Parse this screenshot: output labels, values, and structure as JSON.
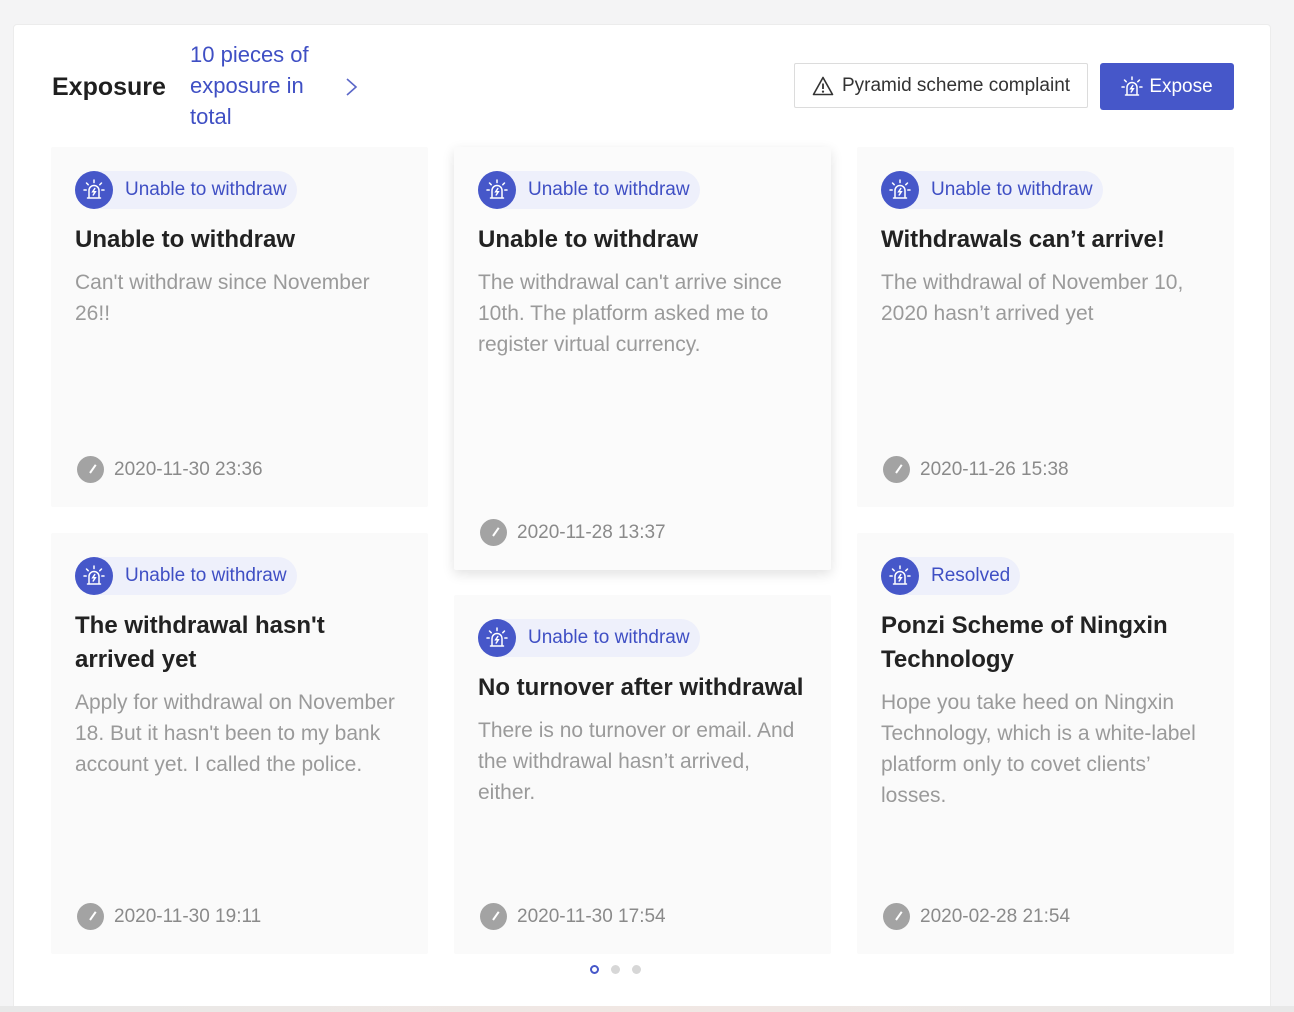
{
  "header": {
    "title": "Exposure",
    "count_link": "10 pieces of exposure in total",
    "complaint_button": "Pyramid scheme complaint",
    "expose_button": "Expose"
  },
  "cards": [
    {
      "tag": "Unable to withdraw",
      "title": "Unable to withdraw",
      "desc": "Can't withdraw since November 26!!",
      "time": "2020-11-30 23:36"
    },
    {
      "tag": "Unable to withdraw",
      "title": "Unable to withdraw",
      "desc": "The withdrawal can't arrive since 10th. The platform asked me to register virtual currency.",
      "time": "2020-11-28 13:37"
    },
    {
      "tag": "Unable to withdraw",
      "title": "Withdrawals can’t arrive!",
      "desc": "The withdrawal of November 10, 2020 hasn’t arrived yet",
      "time": "2020-11-26 15:38"
    },
    {
      "tag": "Unable to withdraw",
      "title": "The withdrawal hasn't arrived yet",
      "desc": "Apply for withdrawal on November 18. But it hasn't been to my bank account yet. I called the police.",
      "time": "2020-11-30 19:11"
    },
    {
      "tag": "Unable to withdraw",
      "title": "No turnover after withdrawal",
      "desc": "There is no turnover or email. And the withdrawal hasn’t arrived, either.",
      "time": "2020-11-30 17:54"
    },
    {
      "tag": "Resolved",
      "title": "Ponzi Scheme of Ningxin Technology",
      "desc": "Hope you take heed on Ningxin Technology, which is a white-label platform only to covet clients’ losses.",
      "time": "2020-02-28 21:54"
    }
  ],
  "pagination": {
    "pages": 3,
    "active": 1
  },
  "colors": {
    "accent": "#4657c9",
    "accent_text": "#3f4fc4",
    "tag_bg": "#eef0fb",
    "muted": "#9a9a9a"
  },
  "icons": {
    "tag": "alarm-siren-icon",
    "time": "clock-icon",
    "complaint": "warning-triangle-icon",
    "link": "chevron-right-icon"
  }
}
